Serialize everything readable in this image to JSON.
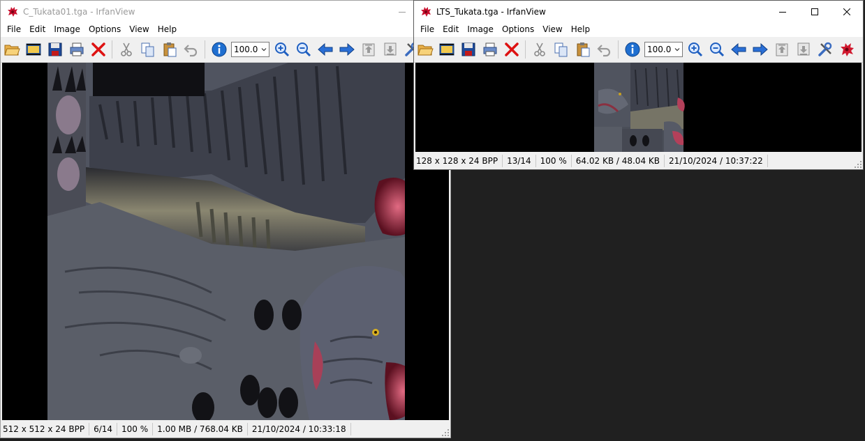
{
  "windows": [
    {
      "title": "C_Tukata01.tga - IrfanView",
      "active": false,
      "menu": [
        "File",
        "Edit",
        "Image",
        "Options",
        "View",
        "Help"
      ],
      "zoom": "100.0",
      "status": [
        "512 x 512 x 24 BPP",
        "6/14",
        "100 %",
        "1.00 MB / 768.04 KB",
        "21/10/2024 / 10:33:18"
      ]
    },
    {
      "title": "LTS_Tukata.tga - IrfanView",
      "active": true,
      "menu": [
        "File",
        "Edit",
        "Image",
        "Options",
        "View",
        "Help"
      ],
      "zoom": "100.0",
      "status": [
        "128 x 128 x 24 BPP",
        "13/14",
        "100 %",
        "64.02 KB / 48.04 KB",
        "21/10/2024 / 10:37:22"
      ]
    }
  ],
  "colors": {
    "desktop": "#202020",
    "window_bg": "#f0f0f0",
    "canvas": "#000000",
    "texture_base": "#4b4f5a",
    "flesh_accent": "#b3405a"
  }
}
